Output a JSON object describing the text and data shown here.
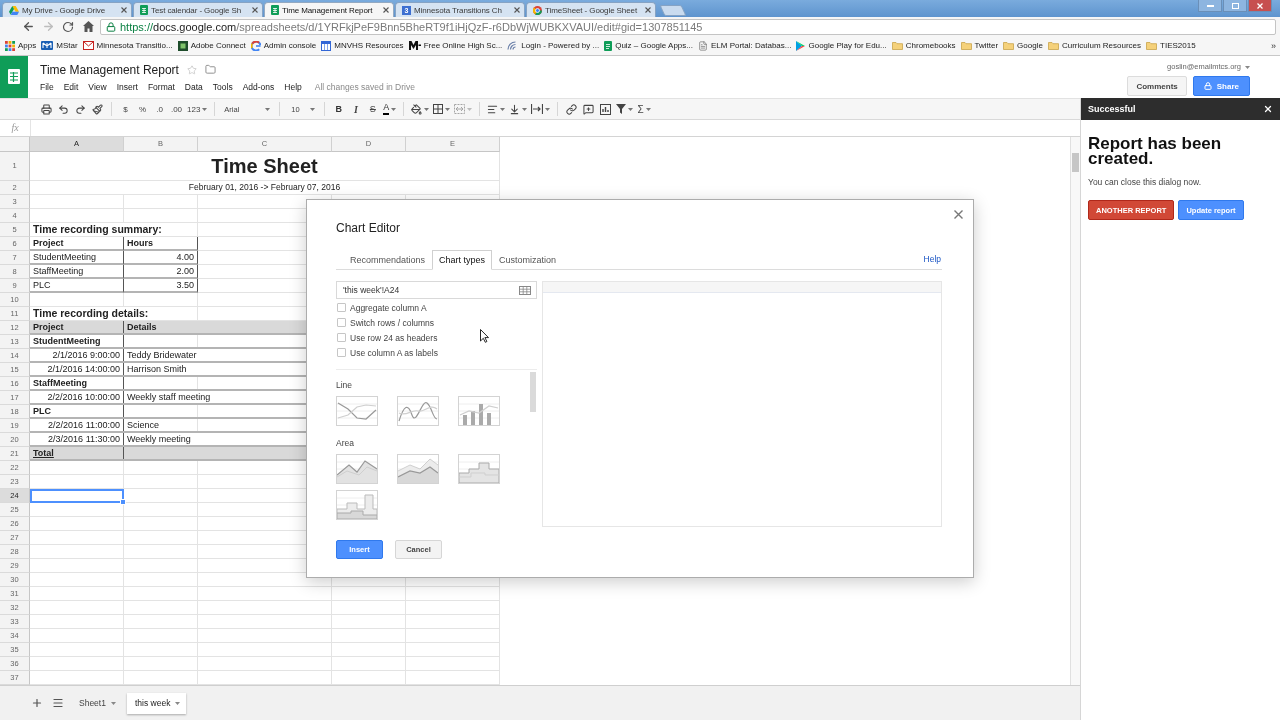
{
  "browser": {
    "tabs": [
      {
        "label": "My Drive - Google Drive",
        "kind": "drive",
        "selected": false
      },
      {
        "label": "Test calendar - Google Sh",
        "kind": "sheets",
        "selected": false
      },
      {
        "label": "Time Management Report",
        "kind": "sheets",
        "selected": true
      },
      {
        "label": "Minnesota Transitions Ch",
        "kind": "numbered",
        "badge": "3",
        "selected": false
      },
      {
        "label": "TimeSheet - Google Sheet",
        "kind": "loading",
        "selected": false
      }
    ],
    "nav": [
      {
        "kind": "back",
        "disabled": false
      },
      {
        "kind": "forward",
        "disabled": true
      },
      {
        "kind": "reload",
        "disabled": false
      },
      {
        "kind": "home",
        "disabled": false
      }
    ],
    "address": {
      "scheme": "https://",
      "host": "docs.google.com",
      "path": "/spreadsheets/d/1YRFkjPeF9Bnn5BheRT9f1iHjQzF-r6DbWjWUBKXVAUI/edit#gid=1307851145"
    },
    "bookmarks": [
      {
        "label": "Apps",
        "kind": "apps"
      },
      {
        "label": "MStar",
        "kind": "mstar"
      },
      {
        "label": "Minnesota Transitio...",
        "kind": "mail"
      },
      {
        "label": "Adobe Connect",
        "kind": "adobe"
      },
      {
        "label": "Admin console",
        "kind": "google"
      },
      {
        "label": "MNVHS Resources",
        "kind": "calendar"
      },
      {
        "label": "Free Online High Sc...",
        "kind": "m_logo"
      },
      {
        "label": "Login - Powered by ...",
        "kind": "signal"
      },
      {
        "label": "Quiz – Google Apps...",
        "kind": "form"
      },
      {
        "label": "ELM Portal: Databas...",
        "kind": "page"
      },
      {
        "label": "Google Play for Edu...",
        "kind": "play"
      },
      {
        "label": "Chromebooks",
        "kind": "folder"
      },
      {
        "label": "Twitter",
        "kind": "folder"
      },
      {
        "label": "Google",
        "kind": "folder"
      },
      {
        "label": "Curriculum Resources",
        "kind": "folder"
      },
      {
        "label": "TIES2015",
        "kind": "folder"
      }
    ],
    "overflow": "»"
  },
  "spreadsheet": {
    "title": "Time Management Report",
    "menus": [
      "File",
      "Edit",
      "View",
      "Insert",
      "Format",
      "Data",
      "Tools",
      "Add-ons",
      "Help"
    ],
    "save_status": "All changes saved in Drive",
    "account": "goslin@emailmtcs.org",
    "actions": [
      {
        "label": "Comments",
        "kind": "secondary"
      },
      {
        "label": "Share",
        "kind": "share"
      }
    ],
    "toolbar": [
      [
        {
          "kind": "print",
          "dropdown": false,
          "disabled": false
        },
        {
          "kind": "undo",
          "dropdown": false,
          "disabled": false
        },
        {
          "kind": "redo",
          "dropdown": false,
          "disabled": false
        },
        {
          "kind": "paint_format",
          "dropdown": false,
          "disabled": false
        }
      ],
      [
        {
          "kind": "text",
          "label": "$",
          "dropdown": false,
          "disabled": false
        },
        {
          "kind": "text",
          "label": "%",
          "dropdown": false,
          "disabled": false
        },
        {
          "kind": "text",
          "label": ".0",
          "dropdown": false,
          "disabled": false
        },
        {
          "kind": "text",
          "label": ".00",
          "dropdown": false,
          "disabled": false
        },
        {
          "kind": "text",
          "label": "123",
          "dropdown": true,
          "disabled": false
        }
      ],
      [
        {
          "kind": "font",
          "label": "Arial",
          "dropdown": true,
          "disabled": false
        }
      ],
      [
        {
          "kind": "size",
          "label": "10",
          "dropdown": true,
          "disabled": false
        }
      ],
      [
        {
          "kind": "bold",
          "label": "B",
          "dropdown": false,
          "disabled": false
        },
        {
          "kind": "italic",
          "label": "I",
          "dropdown": false,
          "disabled": false
        },
        {
          "kind": "strike",
          "label": "S",
          "dropdown": false,
          "disabled": false
        },
        {
          "kind": "color",
          "label": "A",
          "dropdown": true,
          "disabled": false
        }
      ],
      [
        {
          "kind": "fill",
          "dropdown": true,
          "disabled": false
        },
        {
          "kind": "borders",
          "dropdown": true,
          "disabled": false
        },
        {
          "kind": "merge",
          "dropdown": true,
          "disabled": true
        }
      ],
      [
        {
          "kind": "align",
          "dropdown": true,
          "disabled": false
        },
        {
          "kind": "valign",
          "dropdown": true,
          "disabled": false
        },
        {
          "kind": "wrap",
          "dropdown": true,
          "disabled": false
        }
      ],
      [
        {
          "kind": "link",
          "dropdown": false,
          "disabled": false
        },
        {
          "kind": "comment",
          "dropdown": false,
          "disabled": false
        },
        {
          "kind": "chart",
          "dropdown": false,
          "disabled": false
        },
        {
          "kind": "filter",
          "dropdown": true,
          "disabled": false
        },
        {
          "kind": "function",
          "label": "Σ",
          "dropdown": true,
          "disabled": false
        }
      ]
    ],
    "formula_label": "fx",
    "columns": [
      {
        "label": "A",
        "selected": true
      },
      {
        "label": "B",
        "selected": false
      },
      {
        "label": "C",
        "selected": false
      },
      {
        "label": "D",
        "selected": false
      },
      {
        "label": "E",
        "selected": false
      }
    ],
    "rows": [
      {
        "number": "1",
        "kind": "title",
        "selected": false,
        "cells": [
          "Time Sheet"
        ]
      },
      {
        "number": "2",
        "kind": "subtitle",
        "selected": false,
        "cells": [
          "February 01, 2016 -> February 07, 2016"
        ]
      },
      {
        "number": "3",
        "kind": "blank",
        "selected": false
      },
      {
        "number": "4",
        "kind": "blank",
        "selected": false
      },
      {
        "number": "5",
        "kind": "heading",
        "selected": false,
        "cells": [
          "Time recording summary:"
        ]
      },
      {
        "number": "6",
        "kind": "summary_header",
        "selected": false,
        "cells": [
          "Project",
          "Hours"
        ]
      },
      {
        "number": "7",
        "kind": "summary",
        "selected": false,
        "cells": [
          "StudentMeeting",
          "4.00"
        ]
      },
      {
        "number": "8",
        "kind": "summary",
        "selected": false,
        "cells": [
          "StaffMeeting",
          "2.00"
        ]
      },
      {
        "number": "9",
        "kind": "summary",
        "selected": false,
        "cells": [
          "PLC",
          "3.50"
        ]
      },
      {
        "number": "10",
        "kind": "blank",
        "selected": false
      },
      {
        "number": "11",
        "kind": "heading",
        "selected": false,
        "cells": [
          "Time recording details:"
        ]
      },
      {
        "number": "12",
        "kind": "detail_header",
        "selected": false,
        "cells": [
          "Project",
          "Details"
        ]
      },
      {
        "number": "13",
        "kind": "group",
        "selected": false,
        "cells": [
          "StudentMeeting"
        ]
      },
      {
        "number": "14",
        "kind": "entry",
        "selected": false,
        "cells": [
          "2/1/2016 9:00:00",
          "Teddy Bridewater"
        ]
      },
      {
        "number": "15",
        "kind": "entry",
        "selected": false,
        "cells": [
          "2/1/2016 14:00:00",
          "Harrison Smith"
        ]
      },
      {
        "number": "16",
        "kind": "group",
        "selected": false,
        "cells": [
          "StaffMeeting"
        ]
      },
      {
        "number": "17",
        "kind": "entry",
        "selected": false,
        "cells": [
          "2/2/2016 10:00:00",
          "Weekly staff meeting"
        ]
      },
      {
        "number": "18",
        "kind": "group",
        "selected": false,
        "cells": [
          "PLC"
        ]
      },
      {
        "number": "19",
        "kind": "entry",
        "selected": false,
        "cells": [
          "2/2/2016 11:00:00",
          "Science"
        ]
      },
      {
        "number": "20",
        "kind": "entry",
        "selected": false,
        "cells": [
          "2/3/2016 11:30:00",
          "Weekly meeting"
        ]
      },
      {
        "number": "21",
        "kind": "total",
        "selected": false,
        "cells": [
          "Total"
        ]
      },
      {
        "number": "22",
        "kind": "blank",
        "selected": false
      },
      {
        "number": "23",
        "kind": "blank",
        "selected": false
      },
      {
        "number": "24",
        "kind": "blank",
        "selected": true
      },
      {
        "number": "25",
        "kind": "blank",
        "selected": false
      },
      {
        "number": "26",
        "kind": "blank",
        "selected": false
      },
      {
        "number": "27",
        "kind": "blank",
        "selected": false
      },
      {
        "number": "28",
        "kind": "blank",
        "selected": false
      },
      {
        "number": "29",
        "kind": "blank",
        "selected": false
      },
      {
        "number": "30",
        "kind": "blank",
        "selected": false
      },
      {
        "number": "31",
        "kind": "blank",
        "selected": false
      },
      {
        "number": "32",
        "kind": "blank",
        "selected": false
      },
      {
        "number": "33",
        "kind": "blank",
        "selected": false
      },
      {
        "number": "34",
        "kind": "blank",
        "selected": false
      },
      {
        "number": "35",
        "kind": "blank",
        "selected": false
      },
      {
        "number": "36",
        "kind": "blank",
        "selected": false
      },
      {
        "number": "37",
        "kind": "blank",
        "selected": false
      }
    ],
    "sheet_tabs": [
      {
        "label": "Sheet1",
        "selected": false
      },
      {
        "label": "this week",
        "selected": true
      }
    ]
  },
  "sidebar": {
    "title": "Successful",
    "heading": "Report has been created.",
    "message": "You can close this dialog now.",
    "buttons": [
      {
        "label": "ANOTHER REPORT",
        "kind": "danger"
      },
      {
        "label": "Update report",
        "kind": "primary"
      }
    ]
  },
  "chart_editor": {
    "title": "Chart Editor",
    "tabs": [
      {
        "label": "Recommendations",
        "selected": false
      },
      {
        "label": "Chart types",
        "selected": true
      },
      {
        "label": "Customization",
        "selected": false
      }
    ],
    "help": "Help",
    "range": "'this week'!A24",
    "options": [
      {
        "label": "Aggregate column A",
        "checked": false
      },
      {
        "label": "Switch rows / columns",
        "checked": false
      },
      {
        "label": "Use row 24 as headers",
        "checked": false
      },
      {
        "label": "Use column A as labels",
        "checked": false
      }
    ],
    "chart_groups": [
      {
        "label": "Line",
        "types": [
          {
            "kind": "line"
          },
          {
            "kind": "smooth_line"
          },
          {
            "kind": "combo"
          }
        ]
      },
      {
        "label": "Area",
        "types": [
          {
            "kind": "area"
          },
          {
            "kind": "stacked_area"
          },
          {
            "kind": "stepped_area"
          },
          {
            "kind": "stepped_stacked"
          }
        ]
      }
    ],
    "buttons": [
      {
        "label": "Insert",
        "kind": "primary"
      },
      {
        "label": "Cancel",
        "kind": "secondary"
      }
    ]
  }
}
